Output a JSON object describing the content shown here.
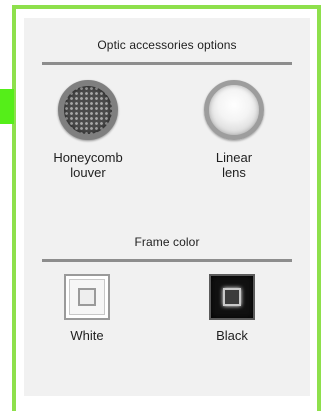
{
  "colors": {
    "frame_border": "#8ee04c",
    "side_tab": "#55ee19",
    "panel_bg": "#f1f1f1",
    "rule": "#8d8d8d"
  },
  "optic": {
    "title": "Optic accessories options",
    "options": [
      {
        "icon": "honeycomb-louver-icon",
        "label_line1": "Honeycomb",
        "label_line2": "louver"
      },
      {
        "icon": "linear-lens-icon",
        "label_line1": "Linear",
        "label_line2": "lens"
      }
    ]
  },
  "frame_color": {
    "title": "Frame color",
    "options": [
      {
        "icon": "white-frame-swatch",
        "label": "White"
      },
      {
        "icon": "black-frame-swatch",
        "label": "Black"
      }
    ]
  }
}
